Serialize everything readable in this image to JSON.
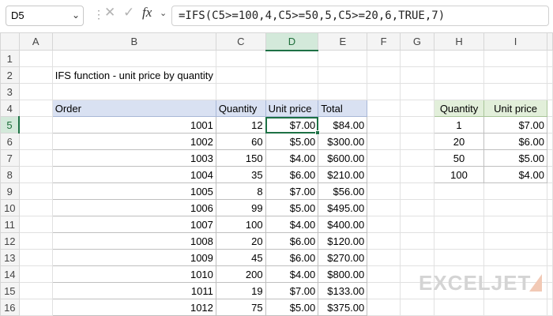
{
  "name_box": {
    "value": "D5"
  },
  "formula_bar": {
    "cancel_glyph": "✕",
    "enter_glyph": "✓",
    "fx_label": "fx",
    "formula": "=IFS(C5>=100,4,C5>=50,5,C5>=20,6,TRUE,7)"
  },
  "columns": [
    "A",
    "B",
    "C",
    "D",
    "E",
    "F",
    "G",
    "H",
    "I"
  ],
  "selected_column": "D",
  "selected_row": 5,
  "rows": [
    1,
    2,
    3,
    4,
    5,
    6,
    7,
    8,
    9,
    10,
    11,
    12,
    13,
    14,
    15,
    16
  ],
  "title": "IFS function - unit price by quantity",
  "orders_table": {
    "headers": [
      "Order",
      "Quantity",
      "Unit price",
      "Total"
    ],
    "rows": [
      [
        "1001",
        "12",
        "$7.00",
        "$84.00"
      ],
      [
        "1002",
        "60",
        "$5.00",
        "$300.00"
      ],
      [
        "1003",
        "150",
        "$4.00",
        "$600.00"
      ],
      [
        "1004",
        "35",
        "$6.00",
        "$210.00"
      ],
      [
        "1005",
        "8",
        "$7.00",
        "$56.00"
      ],
      [
        "1006",
        "99",
        "$5.00",
        "$495.00"
      ],
      [
        "1007",
        "100",
        "$4.00",
        "$400.00"
      ],
      [
        "1008",
        "20",
        "$6.00",
        "$120.00"
      ],
      [
        "1009",
        "45",
        "$6.00",
        "$270.00"
      ],
      [
        "1010",
        "200",
        "$4.00",
        "$800.00"
      ],
      [
        "1011",
        "19",
        "$7.00",
        "$133.00"
      ],
      [
        "1012",
        "75",
        "$5.00",
        "$375.00"
      ]
    ]
  },
  "lookup_table": {
    "headers": [
      "Quantity",
      "Unit price"
    ],
    "rows": [
      [
        "1",
        "$7.00"
      ],
      [
        "20",
        "$6.00"
      ],
      [
        "50",
        "$5.00"
      ],
      [
        "100",
        "$4.00"
      ]
    ]
  },
  "logo": {
    "text": "EXCELJET"
  },
  "colors": {
    "accent_green": "#1e7145",
    "header_blue": "#d9e1f2",
    "header_green": "#e2efda"
  },
  "icons": {
    "name_box_dropdown": "chevron-down-icon",
    "cancel": "close-icon",
    "enter": "check-icon",
    "function": "fx-icon"
  }
}
